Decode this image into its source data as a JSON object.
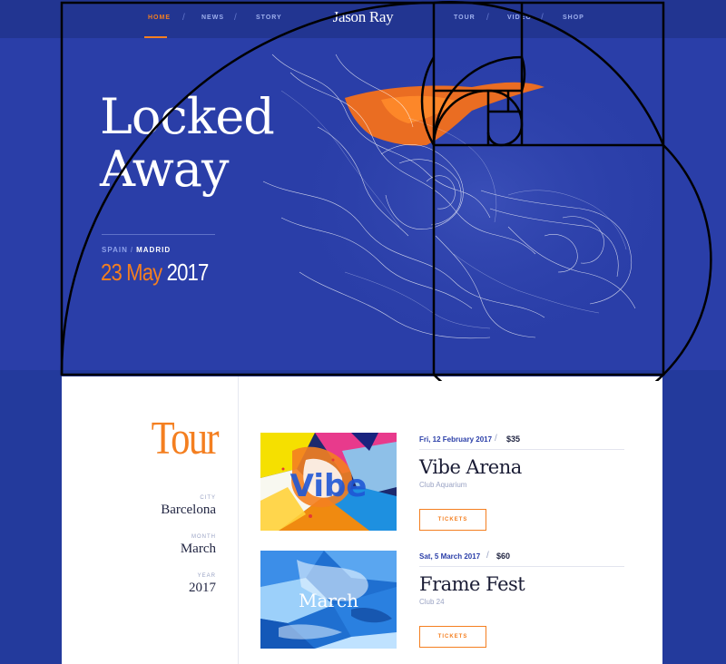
{
  "nav": {
    "brand": "Jason Ray",
    "left_items": [
      "HOME",
      "NEWS",
      "STORY"
    ],
    "right_items": [
      "TOUR",
      "VIDEO",
      "SHOP"
    ],
    "active": "HOME"
  },
  "hero": {
    "title_line1": "Locked",
    "title_line2": "Away",
    "country": "SPAIN",
    "city": "MADRID",
    "date_daymonth": "23 May",
    "date_year": "2017"
  },
  "tour": {
    "title": "Tour",
    "city_label": "CITY",
    "city_value": "Barcelona",
    "month_label": "MONTH",
    "month_value": "March",
    "year_label": "YEAR",
    "year_value": "2017"
  },
  "events": [
    {
      "date": "Fri, 12 February 2017",
      "price": "$35",
      "title": "Vibe Arena",
      "venue": "Club Aquarium",
      "button": "TICKETS",
      "image_text": "Vibe"
    },
    {
      "date": "Sat, 5 March 2017",
      "price": "$60",
      "title": "Frame Fest",
      "venue": "Club 24",
      "button": "TICKETS",
      "image_text": "March"
    }
  ],
  "colors": {
    "background": "#233a9c",
    "hero": "#2a3ea8",
    "accent": "#f47f20",
    "white": "#ffffff"
  }
}
